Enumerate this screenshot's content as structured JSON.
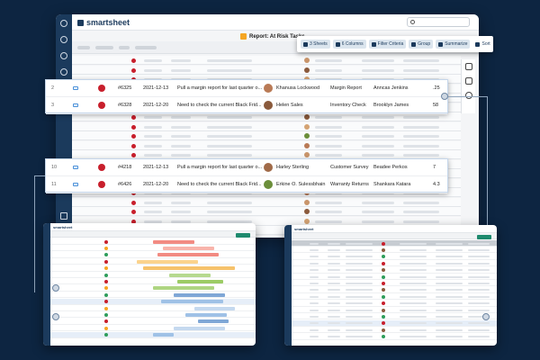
{
  "app": {
    "brand": "smartsheet",
    "report_title": "Report: At Risk Tasks",
    "accent": "#1b3a5c",
    "risk_color": "#c81f2c"
  },
  "toolbar": {
    "sheets": "3 Sheets",
    "columns": "6 Columns",
    "filter": "Filter Criteria",
    "group": "Group",
    "summarize": "Summarize",
    "sort": "Sort"
  },
  "top_rows": [
    {
      "row": "2",
      "id": "#6325",
      "date": "2021-12-13",
      "task": "Pull a margin report for last quarter o...",
      "owner": "Khanusa Lockwood",
      "project": "Margin Report",
      "assignee": "Anncas Jenkins",
      "value": ".25"
    },
    {
      "row": "3",
      "id": "#6328",
      "date": "2021-12-20",
      "task": "Need to check the current Black Frid...",
      "owner": "Helen Sales",
      "project": "Inventory Check",
      "assignee": "Brooklyn James",
      "value": "58"
    }
  ],
  "bottom_rows": [
    {
      "row": "10",
      "id": "#4218",
      "date": "2021-12-13",
      "task": "Pull a margin report for last quarter o...",
      "owner": "Harley Sterling",
      "project": "Customer Survey",
      "assignee": "Beadee Perkos",
      "value": "7"
    },
    {
      "row": "11",
      "id": "#6426",
      "date": "2021-12-20",
      "task": "Need to check the current Black Frid...",
      "owner": "Erkine O. Sulessbhain",
      "project": "Warranty Returns",
      "assignee": "Shankara Katara",
      "value": "4.3"
    }
  ],
  "lower_windows": {
    "left_brand": "smartsheet",
    "right_brand": "smartsheet"
  }
}
